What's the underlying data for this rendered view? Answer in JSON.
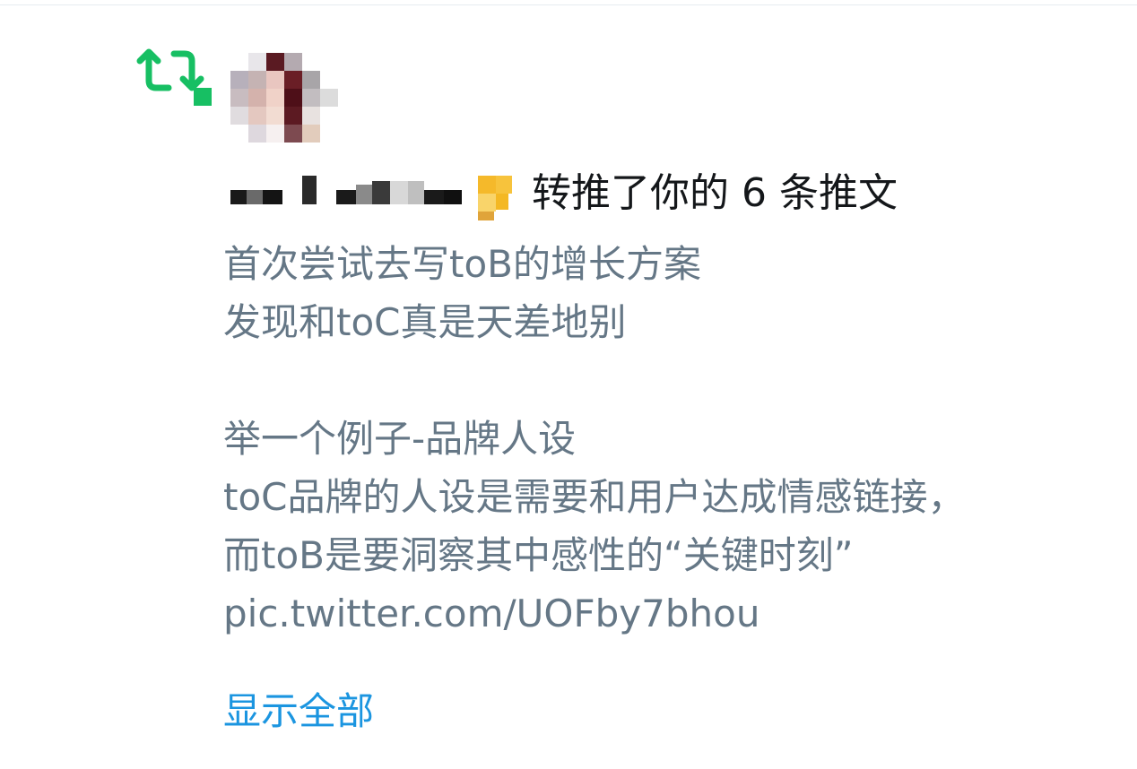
{
  "notification": {
    "type_icon": "retweet-icon",
    "accent_color": "#17bf63",
    "avatar_icon": "user-avatar-pixelated",
    "actor_name_redacted": true,
    "badge_icon": "yellow-badge-icon",
    "action_text": "转推了你的 6 条推文"
  },
  "tweet": {
    "lines": [
      "首次尝试去写toB的增长方案",
      "发现和toC真是天差地别",
      "",
      "举一个例子-品牌人设",
      "toC品牌的人设是需要和用户达成情感链接，",
      "而toB是要洞察其中感性的“关键时刻”",
      "pic.twitter.com/UOFby7bhou"
    ],
    "text_color": "#657786"
  },
  "show_all_label": "显示全部",
  "link_color": "#1b95e0"
}
